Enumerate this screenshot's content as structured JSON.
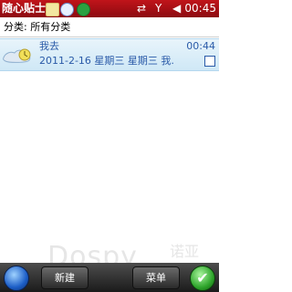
{
  "app": {
    "title": "随心贴士",
    "icons": [
      "notes-icon",
      "search-icon",
      "sync-icon"
    ],
    "status": {
      "sync_icon": "⇄",
      "signal_icon": "Y",
      "volume_icon": "◀",
      "time": "00:45"
    }
  },
  "category": {
    "label": "分类: 所有分类"
  },
  "notes": [
    {
      "title": "我去",
      "time": "00:44",
      "summary": "2011-2-16 星期三 星期三 我."
    }
  ],
  "watermark": {
    "text": "Dospy",
    "suffix": "诺亚"
  },
  "toolbar": {
    "new_label": "新建",
    "menu_label": "菜单",
    "ok_icon": "✔"
  },
  "colors": {
    "titlebar": "#a80f16",
    "selection_text": "#2a5aa8",
    "bottombar": "#2c2c2c"
  }
}
